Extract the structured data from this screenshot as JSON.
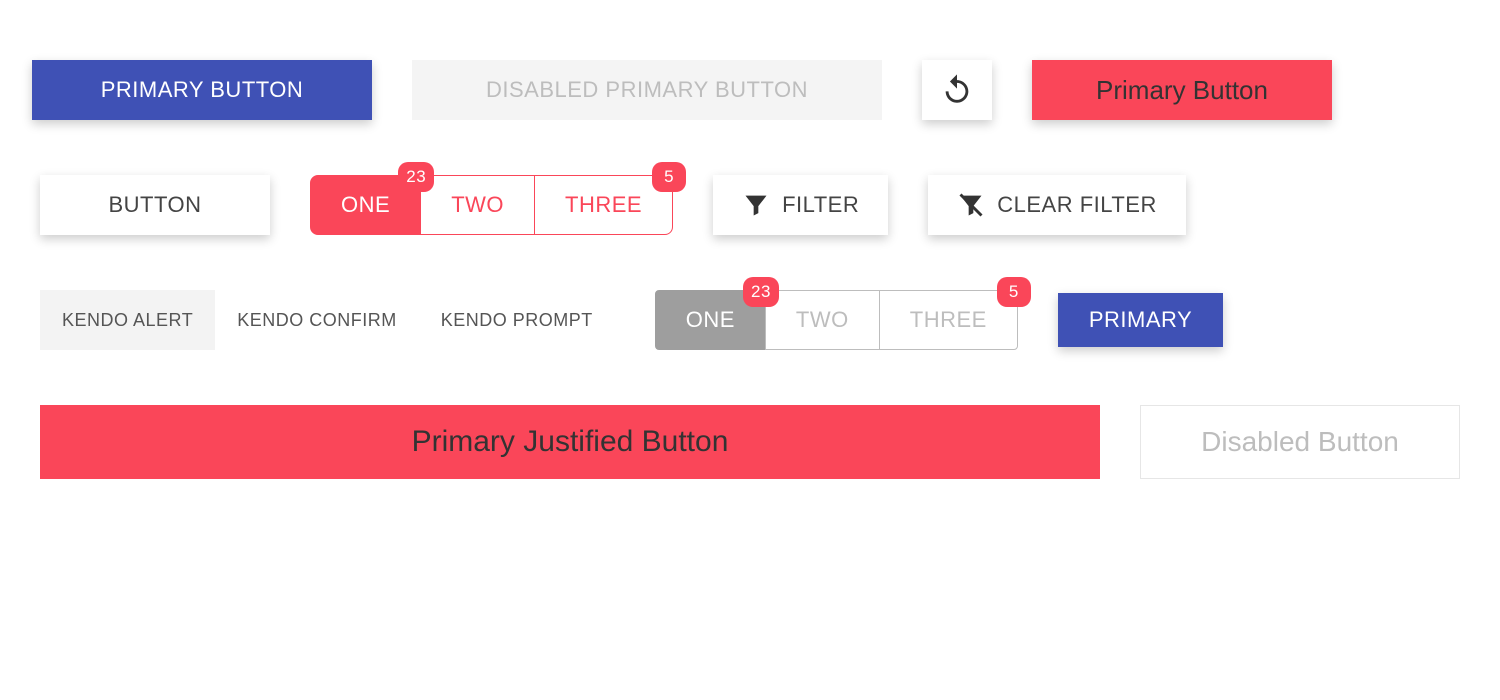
{
  "row1": {
    "primary_blue": "PRIMARY BUTTON",
    "disabled_primary": "DISABLED PRIMARY BUTTON",
    "refresh_icon": "refresh",
    "primary_red": "Primary Button"
  },
  "row2": {
    "plain": "BUTTON",
    "group_red": {
      "items": [
        "ONE",
        "TWO",
        "THREE"
      ],
      "badges": {
        "0": "23",
        "2": "5"
      },
      "active_index": 0
    },
    "filter": "FILTER",
    "clear_filter": "CLEAR FILTER"
  },
  "row3": {
    "flat": [
      "KENDO ALERT",
      "KENDO CONFIRM",
      "KENDO PROMPT"
    ],
    "group_grey": {
      "items": [
        "ONE",
        "TWO",
        "THREE"
      ],
      "badges": {
        "0": "23",
        "2": "5"
      },
      "active_index": 0
    },
    "primary_small_blue": "PRIMARY"
  },
  "row4": {
    "justified_red": "Primary Justified Button",
    "disabled_plain": "Disabled Button"
  },
  "colors": {
    "blue": "#3f51b5",
    "red": "#fa4659",
    "grey": "#9e9e9e",
    "text": "#444"
  }
}
